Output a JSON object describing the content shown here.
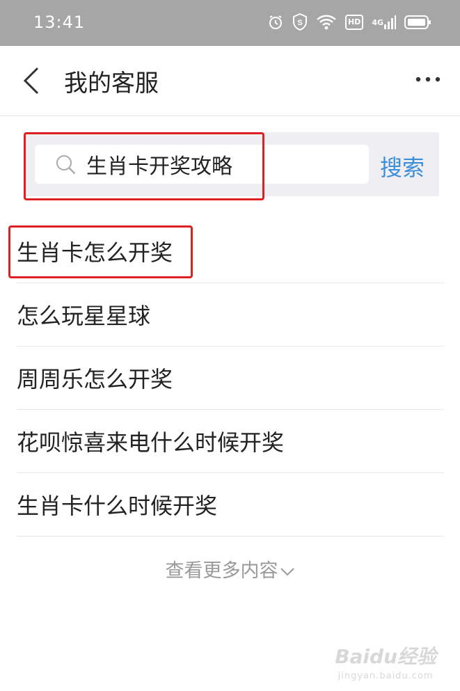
{
  "status_bar": {
    "time": "13:41",
    "hd_label": "HD",
    "network_label": "4G"
  },
  "nav": {
    "title": "我的客服"
  },
  "search": {
    "query": "生肖卡开奖攻略",
    "button_label": "搜索"
  },
  "results": [
    "生肖卡怎么开奖",
    "怎么玩星星球",
    "周周乐怎么开奖",
    "花呗惊喜来电什么时候开奖",
    "生肖卡什么时候开奖"
  ],
  "more": {
    "label": "查看更多内容"
  },
  "watermark": {
    "main": "Baidu经验",
    "sub": "jingyan.baidu.com"
  },
  "colors": {
    "accent": "#3d8ed8",
    "highlight": "#e02020",
    "status_bar": "#a6a6a6"
  }
}
